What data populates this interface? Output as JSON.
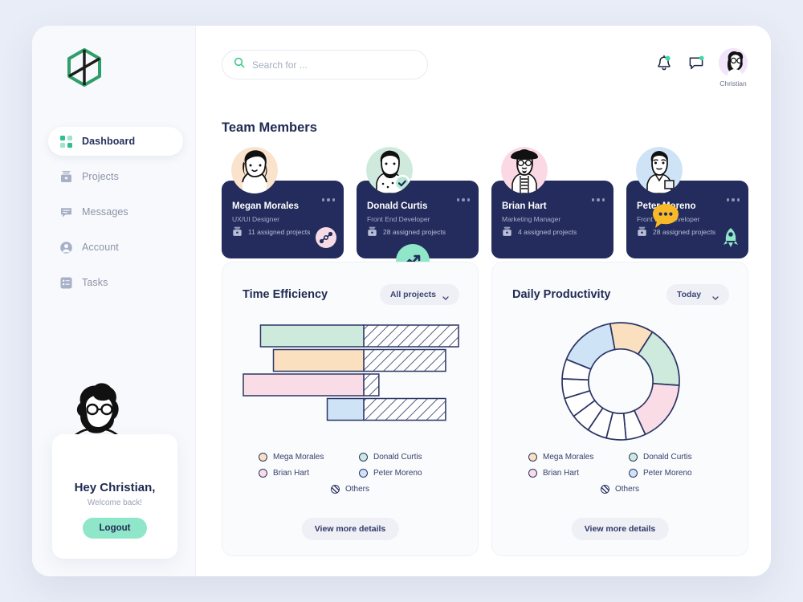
{
  "brand": {
    "logo_icon": "cube-logo-icon",
    "logo_color": "#2f9e68"
  },
  "sidebar": {
    "items": [
      {
        "label": "Dashboard",
        "icon": "grid-icon",
        "active": true
      },
      {
        "label": "Projects",
        "icon": "briefcase-icon",
        "active": false
      },
      {
        "label": "Messages",
        "icon": "chat-icon",
        "active": false
      },
      {
        "label": "Account",
        "icon": "user-circle-icon",
        "active": false
      },
      {
        "label": "Tasks",
        "icon": "list-icon",
        "active": false
      }
    ],
    "profile": {
      "greeting": "Hey Christian,",
      "subtitle": "Welcome back!",
      "logout_label": "Logout",
      "logout_color": "#8fe6c8",
      "illustration": "bearded-man-illustration"
    }
  },
  "header": {
    "search": {
      "placeholder": "Search for ...",
      "value": "",
      "icon": "search-icon",
      "icon_color": "#3dc98f"
    },
    "notification_icon": "bell-icon",
    "notification_badge": true,
    "messages_icon": "chat-bubble-icon",
    "messages_badge": true,
    "badge_color": "#3dd9a0",
    "account_name": "Christian",
    "avatar_icon": "user-avatar"
  },
  "main": {
    "section_title": "Team Members",
    "members": [
      {
        "name": "Megan Morales",
        "role": "UX/UI Designer",
        "projects": "11 assigned projects",
        "badge_icon": "share-nodes-icon",
        "badge_color": "#f6dbe6",
        "avatar_bg": "#fae3cd",
        "menu_icon": "more-dots-icon",
        "projects_icon": "briefcase-icon"
      },
      {
        "name": "Donald Curtis",
        "role": "Front End Developer",
        "projects": "28 assigned projects",
        "badge_icon": "check-circle-icon",
        "badge_color": "#b9e8d4",
        "avatar_bg": "#cfeadd",
        "menu_icon": "more-dots-icon",
        "projects_icon": "briefcase-icon"
      },
      {
        "name": "Brian Hart",
        "role": "Marketing Manager",
        "projects": "4 assigned projects",
        "badge_icon": "bar-chart-icon",
        "badge_color": "#fbbf5f",
        "avatar_bg": "#fbd9e4",
        "menu_icon": "more-dots-icon",
        "projects_icon": "briefcase-icon"
      },
      {
        "name": "Peter Moreno",
        "role": "Front End Developer",
        "projects": "28 assigned projects",
        "badge_icon": "rocket-icon",
        "badge_color": "#8fe6c8",
        "avatar_bg": "#cfe3f7",
        "menu_icon": "more-dots-icon",
        "projects_icon": "briefcase-icon"
      }
    ],
    "decorations": [
      {
        "icon": "trending-up-icon",
        "color": "#8fe6c8"
      },
      {
        "icon": "speech-bubble-icon",
        "color": "#f7b927"
      },
      {
        "icon": "bar-chart-icon",
        "color": "#fbbf5f"
      },
      {
        "icon": "pie-chart-icon",
        "color": "#f9a8c9"
      }
    ]
  },
  "cards": {
    "time_efficiency": {
      "title": "Time Efficiency",
      "dropdown_label": "All projects",
      "dropdown_icon": "chevron-down-icon",
      "more_label": "View more details"
    },
    "daily_productivity": {
      "title": "Daily Productivity",
      "dropdown_label": "Today",
      "dropdown_icon": "chevron-down-icon",
      "more_label": "View more details"
    },
    "legend": [
      {
        "label": "Mega Morales",
        "color": "#fbe0c0"
      },
      {
        "label": "Donald Curtis",
        "color": "#cdeadc"
      },
      {
        "label": "Brian Hart",
        "color": "#fadce6"
      },
      {
        "label": "Peter Moreno",
        "color": "#cfe3f7"
      },
      {
        "label": "Others",
        "color": "hatched"
      }
    ]
  },
  "chart_data": [
    {
      "type": "bar",
      "title": "Time Efficiency",
      "orientation": "horizontal",
      "xlabel": "",
      "ylabel": "",
      "grid": false,
      "legend_position": "bottom",
      "stroke": "#2b3566",
      "note": "Each bar is split: a solid colored 'done' portion and a hatched 'Others' portion. Values are % of the plot width; bars are offset from different start points.",
      "categories": [
        "Donald Curtis",
        "Mega Morales",
        "Brian Hart",
        "Peter Moreno"
      ],
      "series": [
        {
          "name": "filled",
          "values": [
            48,
            42,
            64,
            17
          ]
        },
        {
          "name": "hatched",
          "values": [
            52,
            38,
            7,
            43
          ]
        }
      ],
      "bars": [
        {
          "category": "Donald Curtis",
          "color": "#cdeadc",
          "start_pct": 8,
          "split_pct": 56,
          "end_pct": 100
        },
        {
          "category": "Mega Morales",
          "color": "#fbe0c0",
          "start_pct": 14,
          "split_pct": 56,
          "end_pct": 94
        },
        {
          "category": "Brian Hart",
          "color": "#fadce6",
          "start_pct": 0,
          "split_pct": 56,
          "end_pct": 63
        },
        {
          "category": "Peter Moreno",
          "color": "#cfe3f7",
          "start_pct": 39,
          "split_pct": 56,
          "end_pct": 94
        }
      ]
    },
    {
      "type": "pie",
      "subtype": "donut",
      "title": "Daily Productivity",
      "legend_position": "bottom",
      "stroke": "#2b3566",
      "inner_radius_pct": 55,
      "labels": [
        "Peter Moreno",
        "Mega Morales",
        "Donald Curtis",
        "Brian Hart",
        "Others"
      ],
      "values": [
        16,
        12,
        17,
        17,
        38
      ],
      "colors": [
        "#cfe3f7",
        "#fbe0c0",
        "#cdeadc",
        "#fadce6",
        "#ffffff"
      ],
      "others_segments": 7,
      "start_angle": -68
    }
  ]
}
